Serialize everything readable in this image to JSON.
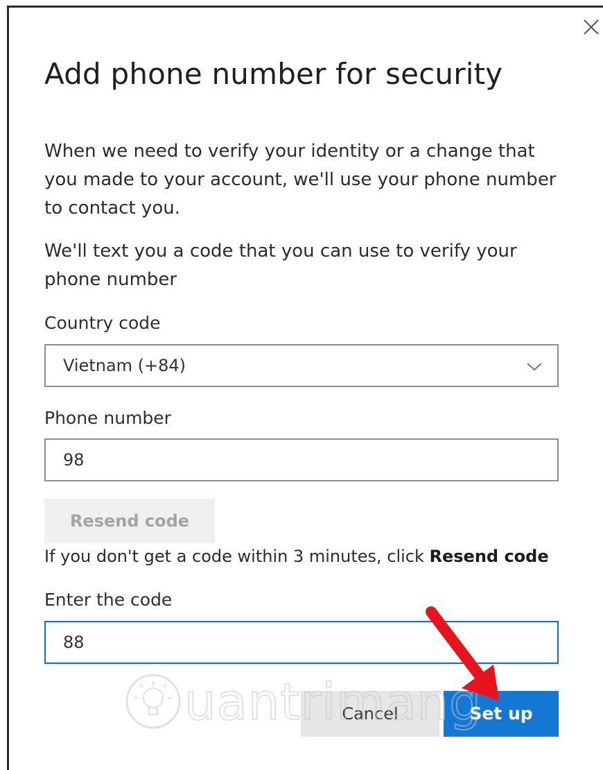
{
  "dialog": {
    "title": "Add phone number for security",
    "description": "When we need to verify your identity or a change that you made to your account, we'll use your phone number to contact you.",
    "sms_note": "We'll text you a code that you can use to verify your phone number"
  },
  "form": {
    "country_label": "Country code",
    "country_value": "Vietnam (+84)",
    "phone_label": "Phone number",
    "phone_value": "98",
    "resend_label": "Resend code",
    "hint_prefix": "If you don't get a code within 3 minutes, click ",
    "hint_link": "Resend code",
    "code_label": "Enter the code",
    "code_value": "88"
  },
  "actions": {
    "cancel_label": "Cancel",
    "setup_label": "Set up"
  },
  "watermark": {
    "text": "uantrimang"
  },
  "colors": {
    "primary": "#1378d4",
    "focus_border": "#0a6fd0",
    "arrow": "#e8141b"
  },
  "icons": {
    "close": "close-icon",
    "dropdown": "chevron-down-icon",
    "pointer": "red-arrow-icon",
    "watermark_logo": "lightbulb-icon"
  }
}
